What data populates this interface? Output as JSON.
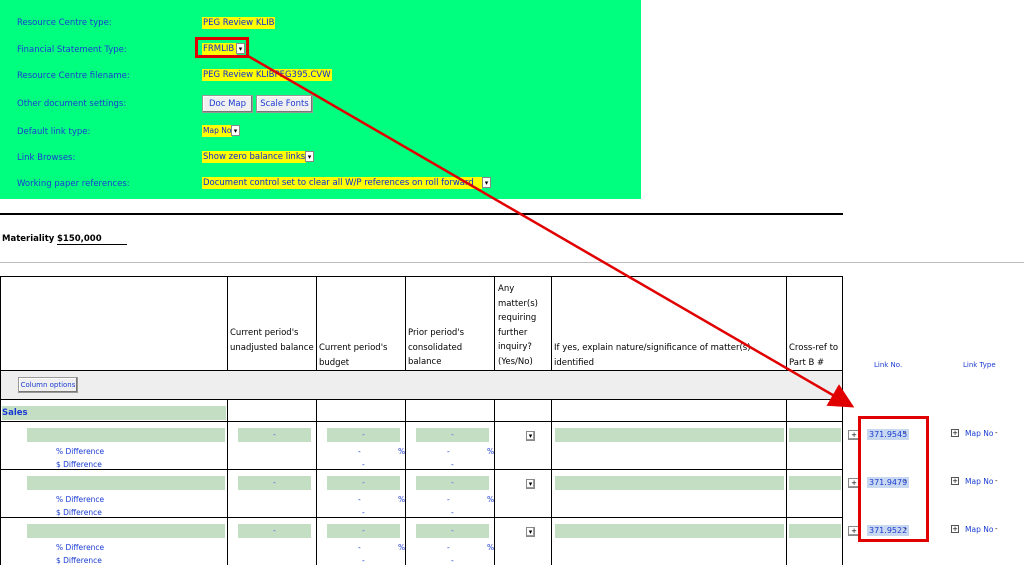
{
  "settings": {
    "resource_type_label": "Resource Centre type:",
    "resource_type_value": "PEG Review KLIB",
    "fin_stmt_label": "Financial Statement Type:",
    "fin_stmt_value": "FRMLIB",
    "filename_label": "Resource Centre filename:",
    "filename_value": "PEG Review KLIBPEG395.CVW",
    "other_docs_label": "Other document settings:",
    "doc_map_button": "Doc Map",
    "scale_fonts_button": "Scale Fonts",
    "default_link_label": "Default link type:",
    "default_link_value": "Map No",
    "link_browses_label": "Link Browses:",
    "link_browses_value": "Show zero balance links",
    "wp_refs_label": "Working paper references:",
    "wp_refs_value": "Document control set to clear all W/P references on roll forward"
  },
  "materiality": {
    "label": "Materiality",
    "value": "$150,000"
  },
  "table": {
    "headers": {
      "current_unadjusted": "Current period's unadjusted balance",
      "current_budget": "Current period's budget",
      "prior_consolidated": "Prior period's consolidated balance",
      "any_matter": "Any matter(s) requiring further inquiry? (Yes/No)",
      "explain": "If yes, explain nature/significance of matter(s) identified",
      "crossref": "Cross-ref to Part B #"
    },
    "column_options_button": "Column options",
    "link_no_header": "Link No.",
    "link_type_header": "Link Type",
    "section_label": "Sales",
    "dash": "-",
    "percent": "%",
    "pct_diff_label": "% Difference",
    "dollar_diff_label": "$ Difference",
    "rows": [
      {
        "link_no": "371.9545",
        "link_type": "Map No"
      },
      {
        "link_no": "371.9479",
        "link_type": "Map No"
      },
      {
        "link_no": "371.9522",
        "link_type": "Map No"
      }
    ]
  },
  "colors": {
    "panel_green": "#00ff7f",
    "highlight_yellow": "#ffff00",
    "annotation_red": "#e00000",
    "cell_green": "#c4dec4",
    "label_blue": "#1a3bd1"
  },
  "icons": [
    "dropdown-arrow-icon",
    "plus-box-icon",
    "annotation-arrow"
  ]
}
